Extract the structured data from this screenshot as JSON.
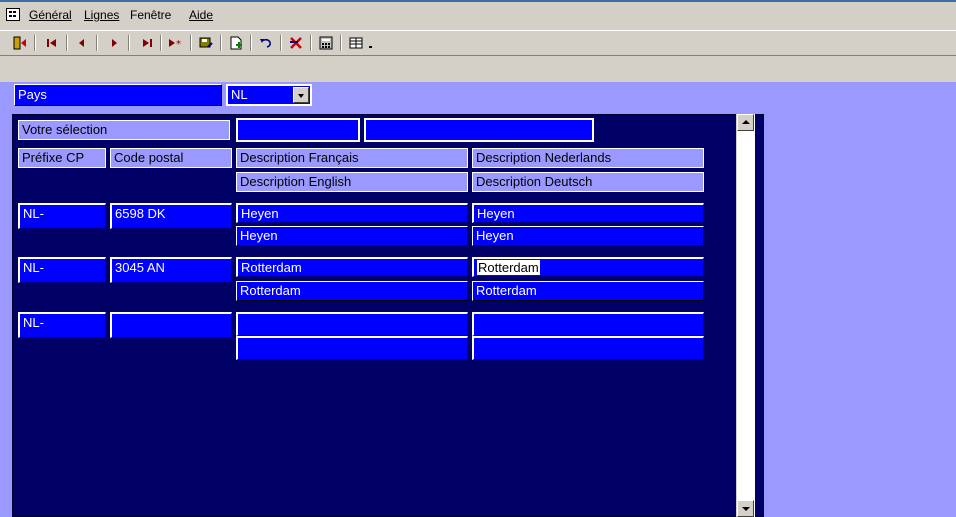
{
  "menu": {
    "general": "Général",
    "lignes": "Lignes",
    "fenetre": "Fenêtre",
    "aide": "Aide"
  },
  "country": {
    "label": "Pays",
    "value": "NL"
  },
  "selection": {
    "label": "Votre sélection",
    "input1": "",
    "input2": ""
  },
  "headers": {
    "prefix": "Préfixe CP",
    "postal": "Code postal",
    "desc_fr": "Description Français",
    "desc_nl": "Description Nederlands",
    "desc_en": "Description English",
    "desc_de": "Description Deutsch"
  },
  "rows": [
    {
      "prefix": "NL-",
      "postal": "6598 DK",
      "fr": "Heyen",
      "nl": "Heyen",
      "en": "Heyen",
      "de": "Heyen"
    },
    {
      "prefix": "NL-",
      "postal": "3045 AN",
      "fr": "Rotterdam",
      "nl": "Rotterdam",
      "en": "Rotterdam",
      "de": "Rotterdam"
    },
    {
      "prefix": "NL-",
      "postal": "",
      "fr": "",
      "nl": "",
      "en": "",
      "de": ""
    }
  ],
  "colors": {
    "panel": "#000066",
    "field": "#0000ff",
    "background": "#9999ff"
  }
}
